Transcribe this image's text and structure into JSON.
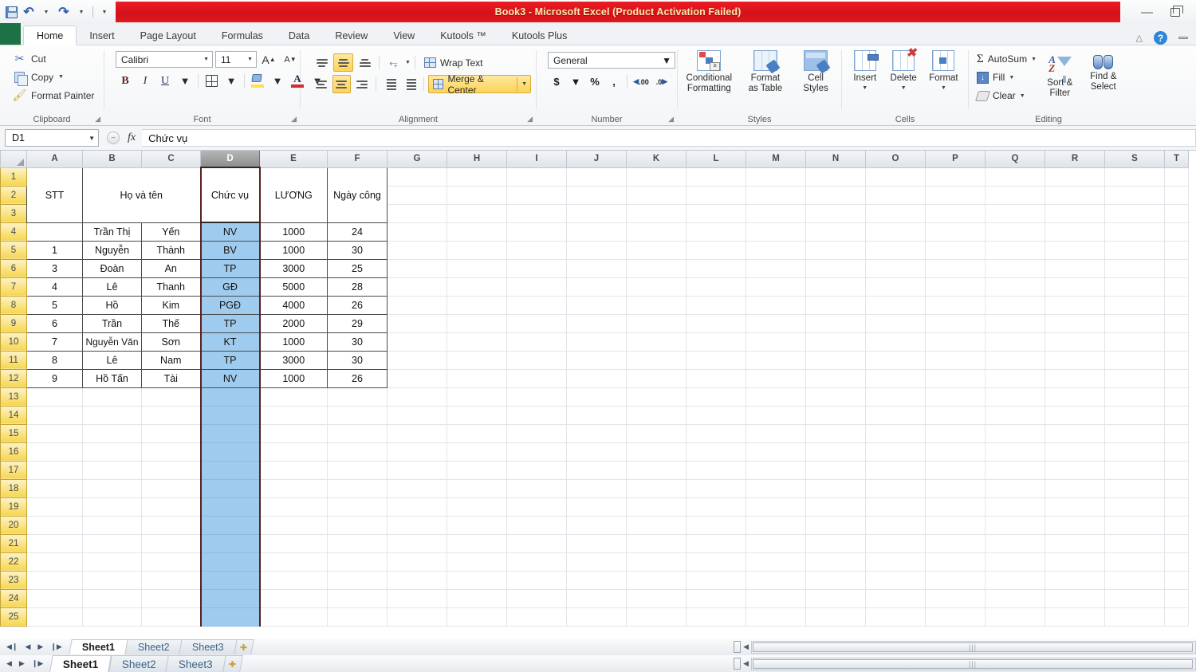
{
  "window": {
    "title": "Book3  -  Microsoft Excel (Product Activation Failed)",
    "minimize": "—",
    "restore": "restore-icon",
    "qat": [
      {
        "name": "save-icon",
        "label": "Save"
      },
      {
        "name": "undo-icon",
        "label": "Undo"
      },
      {
        "name": "redo-icon",
        "label": "Redo"
      },
      {
        "name": "customize-qat-icon",
        "label": "Customize Quick Access Toolbar"
      }
    ]
  },
  "ribbon_tabs": [
    {
      "label": "Home",
      "active": true
    },
    {
      "label": "Insert",
      "active": false
    },
    {
      "label": "Page Layout",
      "active": false
    },
    {
      "label": "Formulas",
      "active": false
    },
    {
      "label": "Data",
      "active": false
    },
    {
      "label": "Review",
      "active": false
    },
    {
      "label": "View",
      "active": false
    },
    {
      "label": "Kutools ™",
      "active": false
    },
    {
      "label": "Kutools Plus",
      "active": false
    }
  ],
  "ribbon": {
    "clipboard": {
      "group_label": "Clipboard",
      "cut": "Cut",
      "copy": "Copy",
      "format_painter": "Format Painter"
    },
    "font": {
      "group_label": "Font",
      "font_name": "Calibri",
      "font_size": "11",
      "grow_font": "A",
      "shrink_font": "A",
      "bold": "B",
      "italic": "I",
      "underline": "U",
      "borders": "borders-icon",
      "fill_color": "fill-color-icon",
      "font_color": "A"
    },
    "alignment": {
      "group_label": "Alignment",
      "wrap_text": "Wrap Text",
      "merge_center": "Merge & Center",
      "top_align": "Top Align",
      "middle_align": "Middle Align",
      "bottom_align": "Bottom Align",
      "align_left": "Align Text Left",
      "align_center": "Center",
      "align_right": "Align Text Right",
      "orientation": "Orientation",
      "decrease_indent": "Decrease Indent",
      "increase_indent": "Increase Indent"
    },
    "number": {
      "group_label": "Number",
      "format": "General",
      "currency": "$",
      "percent": "%",
      "comma": ",",
      "increase_decimal": ".00",
      "decrease_decimal": ".0"
    },
    "styles": {
      "group_label": "Styles",
      "conditional_formatting": "Conditional\nFormatting",
      "conditional_formatting_l1": "Conditional",
      "conditional_formatting_l2": "Formatting",
      "format_as_table_l1": "Format",
      "format_as_table_l2": "as Table",
      "cell_styles_l1": "Cell",
      "cell_styles_l2": "Styles"
    },
    "cells": {
      "group_label": "Cells",
      "insert": "Insert",
      "delete": "Delete",
      "format": "Format"
    },
    "editing": {
      "group_label": "Editing",
      "autosum": "AutoSum",
      "fill": "Fill",
      "clear": "Clear",
      "sort_filter_l1": "Sort &",
      "sort_filter_l2": "Filter",
      "find_select_l1": "Find &",
      "find_select_l2": "Select"
    }
  },
  "formula_bar": {
    "name_box": "D1",
    "fx_label": "fx",
    "value": "Chức vụ"
  },
  "grid": {
    "columns": [
      "A",
      "B",
      "C",
      "D",
      "E",
      "F",
      "G",
      "H",
      "I",
      "J",
      "K",
      "L",
      "M",
      "N",
      "O",
      "P",
      "Q",
      "R",
      "S",
      "T"
    ],
    "selected_column": "D",
    "rows": [
      1,
      2,
      3,
      4,
      5,
      6,
      7,
      8,
      9,
      10,
      11,
      12,
      13,
      14,
      15,
      16,
      17,
      18,
      19,
      20,
      21,
      22,
      23,
      24,
      25
    ],
    "headers": {
      "stt": "STT",
      "ho_va_ten": "Họ và tên",
      "chuc_vu": "Chức vụ",
      "luong": "LƯƠNG",
      "ngay_cong": "Ngày công"
    },
    "data_rows": [
      {
        "row": 4,
        "stt": "",
        "ho": "Trần Thị",
        "ten": "Yến",
        "chuc_vu": "NV",
        "luong": "1000",
        "ngay_cong": "24"
      },
      {
        "row": 5,
        "stt": "1",
        "ho": "Nguyễn",
        "ten": "Thành",
        "chuc_vu": "BV",
        "luong": "1000",
        "ngay_cong": "30"
      },
      {
        "row": 6,
        "stt": "3",
        "ho": "Đoàn",
        "ten": "An",
        "chuc_vu": "TP",
        "luong": "3000",
        "ngay_cong": "25"
      },
      {
        "row": 7,
        "stt": "4",
        "ho": "Lê",
        "ten": "Thanh",
        "chuc_vu": "GĐ",
        "luong": "5000",
        "ngay_cong": "28"
      },
      {
        "row": 8,
        "stt": "5",
        "ho": "Hồ",
        "ten": "Kim",
        "chuc_vu": "PGĐ",
        "luong": "4000",
        "ngay_cong": "26"
      },
      {
        "row": 9,
        "stt": "6",
        "ho": "Trần",
        "ten": "Thế",
        "chuc_vu": "TP",
        "luong": "2000",
        "ngay_cong": "29"
      },
      {
        "row": 10,
        "stt": "7",
        "ho": "Nguyễn Văn",
        "ten": "Sơn",
        "chuc_vu": "KT",
        "luong": "1000",
        "ngay_cong": "30"
      },
      {
        "row": 11,
        "stt": "8",
        "ho": "Lê",
        "ten": "Nam",
        "chuc_vu": "TP",
        "luong": "3000",
        "ngay_cong": "30"
      },
      {
        "row": 12,
        "stt": "9",
        "ho": "Hồ Tấn",
        "ten": "Tài",
        "chuc_vu": "NV",
        "luong": "1000",
        "ngay_cong": "26"
      }
    ]
  },
  "sheet_tabs": {
    "tabs": [
      {
        "label": "Sheet1",
        "active": true
      },
      {
        "label": "Sheet2",
        "active": false
      },
      {
        "label": "Sheet3",
        "active": false
      }
    ],
    "insert_sheet": "insert-worksheet-icon",
    "nav_first": "◀❙",
    "nav_prev": "◀",
    "nav_next": "▶",
    "nav_last": "❙▶"
  },
  "colors": {
    "title_red": "#d2111a",
    "title_text": "#ffe9b0",
    "selection_blue": "#9fccee",
    "rowheader_yellow": "#f6d64e",
    "ribbon_highlight": "#fdd457",
    "file_tab_green": "#1e7145"
  }
}
